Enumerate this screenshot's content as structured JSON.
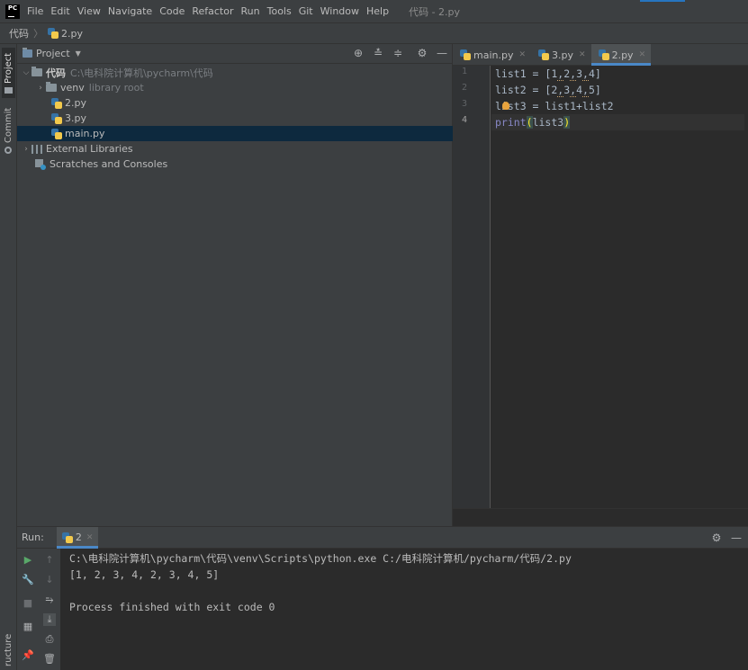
{
  "app": {
    "logo_text": "PC",
    "window_title": "代码 - 2.py"
  },
  "menu": [
    "File",
    "Edit",
    "View",
    "Navigate",
    "Code",
    "Refactor",
    "Run",
    "Tools",
    "Git",
    "Window",
    "Help"
  ],
  "breadcrumb": {
    "project": "代码",
    "file": "2.py"
  },
  "side_tabs": {
    "project": "Project",
    "commit": "Commit",
    "structure": "ructure"
  },
  "project_panel": {
    "title": "Project",
    "tree": {
      "root": {
        "name": "代码",
        "path": "C:\\电科院计算机\\pycharm\\代码"
      },
      "venv": {
        "name": "venv",
        "hint": "library root"
      },
      "files": [
        "2.py",
        "3.py",
        "main.py"
      ],
      "selected_file": "main.py",
      "external": "External Libraries",
      "scratches": "Scratches and Consoles"
    }
  },
  "editor": {
    "tabs": [
      "main.py",
      "3.py",
      "2.py"
    ],
    "active_tab": "2.py",
    "line_numbers": [
      "1",
      "2",
      "3",
      "4"
    ],
    "code": {
      "l1a": "list1 = [",
      "l1n": [
        "1",
        "2",
        "3",
        "4"
      ],
      "l1b": "]",
      "l2a": "list2 = [",
      "l2n": [
        "2",
        "3",
        "4",
        "5"
      ],
      "l2b": "]",
      "l3": "list3 = list1+list2",
      "l4a": "print",
      "l4b": "(",
      "l4c": "list3",
      "l4d": ")"
    }
  },
  "run_panel": {
    "label": "Run:",
    "tab": "2",
    "output": [
      "C:\\电科院计算机\\pycharm\\代码\\venv\\Scripts\\python.exe C:/电科院计算机/pycharm/代码/2.py",
      "[1, 2, 3, 4, 2, 3, 4, 5]",
      "",
      "Process finished with exit code 0"
    ]
  },
  "colors": {
    "accent": "#4a88c7",
    "selection": "#0d293e",
    "editor_bg": "#2b2b2b",
    "panel_bg": "#3c3f41",
    "run_green": "#59a869"
  }
}
